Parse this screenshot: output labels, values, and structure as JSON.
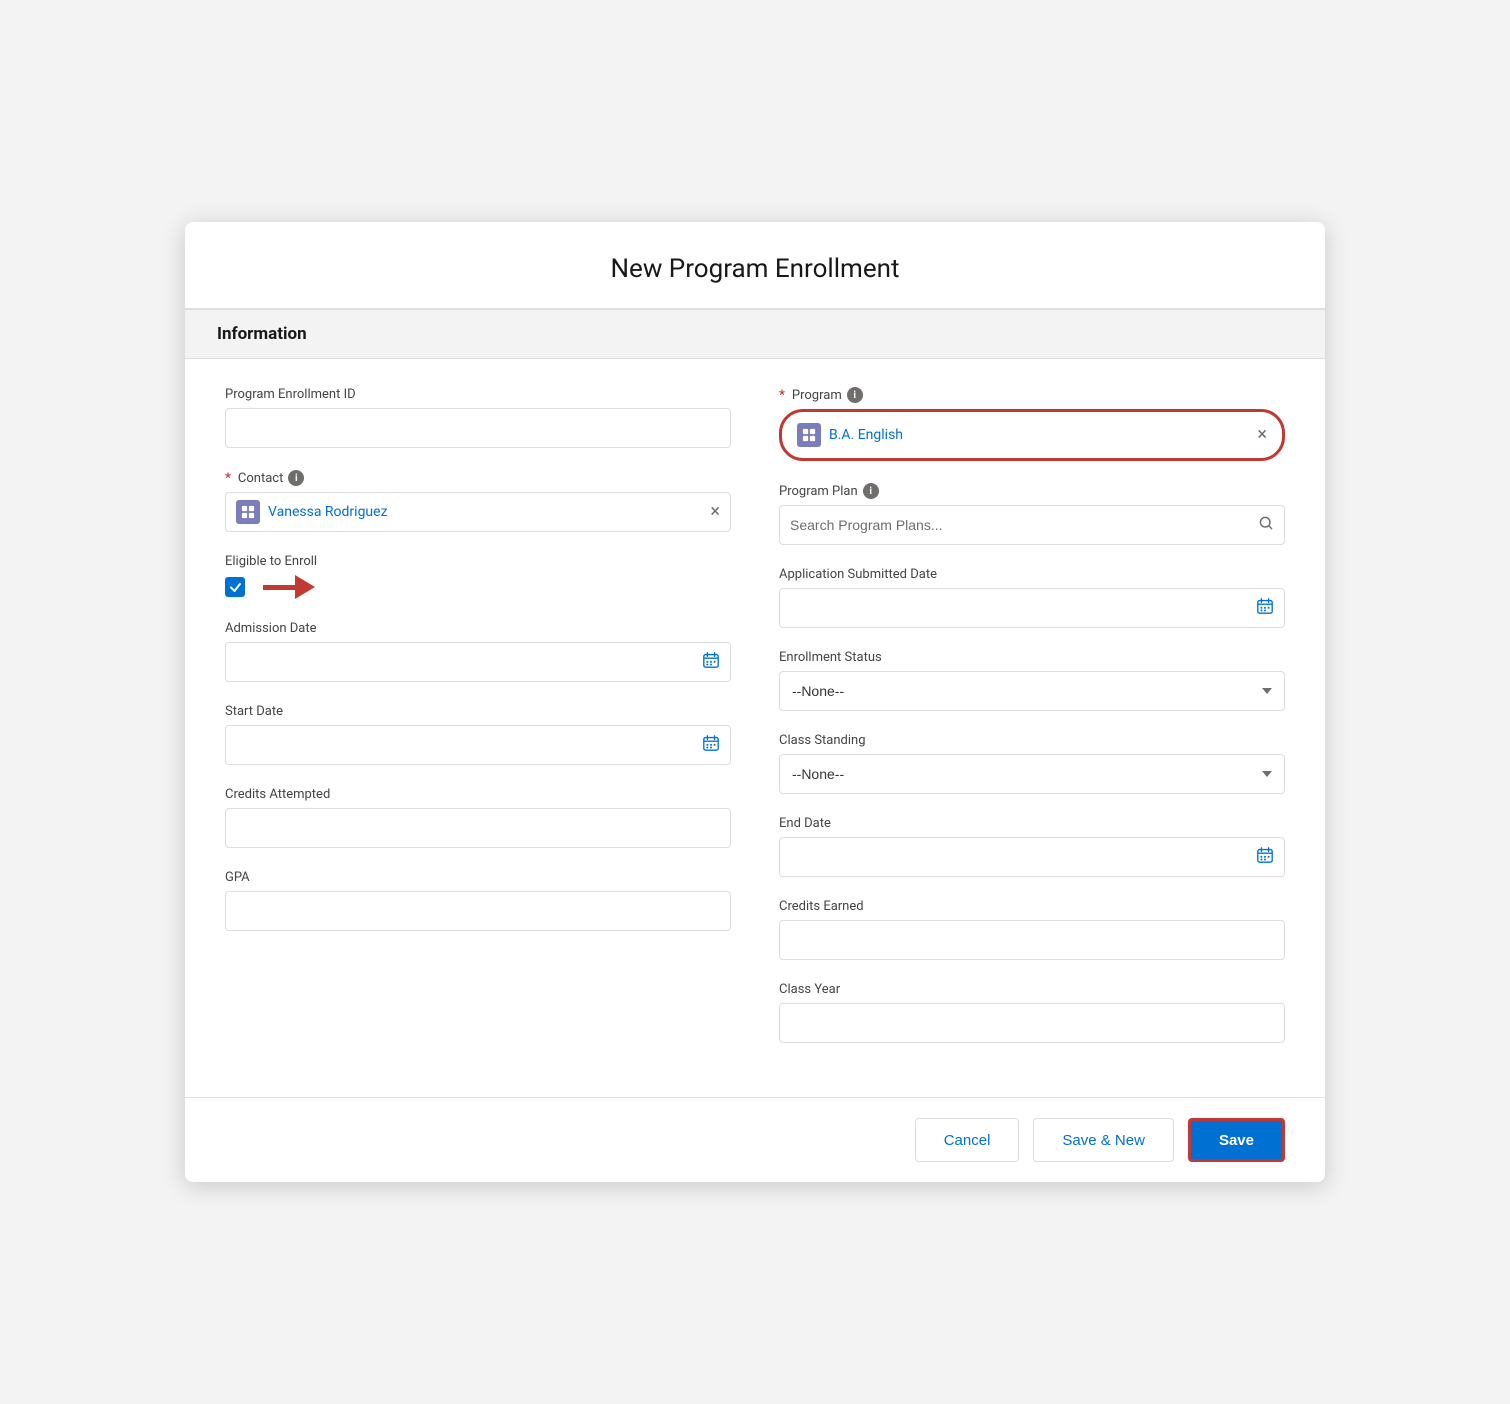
{
  "modal": {
    "title": "New Program Enrollment"
  },
  "section": {
    "label": "Information"
  },
  "fields": {
    "program_enrollment_id": {
      "label": "Program Enrollment ID",
      "value": ""
    },
    "program": {
      "label": "Program",
      "required": true,
      "value": "B.A. English",
      "has_info": true
    },
    "contact": {
      "label": "Contact",
      "required": true,
      "value": "Vanessa Rodriguez",
      "has_info": true
    },
    "program_plan": {
      "label": "Program Plan",
      "has_info": true,
      "placeholder": "Search Program Plans..."
    },
    "eligible_to_enroll": {
      "label": "Eligible to Enroll",
      "checked": true
    },
    "application_submitted_date": {
      "label": "Application Submitted Date"
    },
    "admission_date": {
      "label": "Admission Date"
    },
    "enrollment_status": {
      "label": "Enrollment Status",
      "value": "--None--",
      "options": [
        "--None--"
      ]
    },
    "start_date": {
      "label": "Start Date"
    },
    "class_standing": {
      "label": "Class Standing",
      "value": "--None--",
      "options": [
        "--None--"
      ]
    },
    "credits_attempted": {
      "label": "Credits Attempted"
    },
    "end_date": {
      "label": "End Date"
    },
    "gpa": {
      "label": "GPA"
    },
    "credits_earned": {
      "label": "Credits Earned"
    },
    "class_year": {
      "label": "Class Year"
    }
  },
  "footer": {
    "cancel_label": "Cancel",
    "save_new_label": "Save & New",
    "save_label": "Save"
  },
  "icons": {
    "info": "i",
    "calendar": "📅",
    "search": "🔍",
    "checkmark": "✓",
    "clear": "×"
  }
}
